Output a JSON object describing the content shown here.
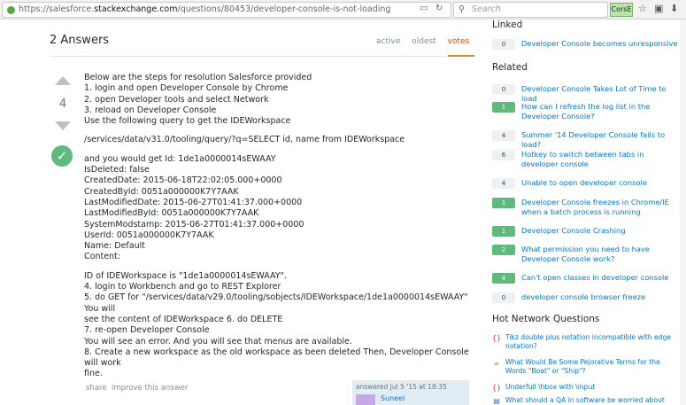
{
  "browser": {
    "url_prefix": "https://salesforce.",
    "url_domain": "stackexchange.com",
    "url_path": "/questions/80453/developer-console-is-not-loading",
    "search_placeholder": "Search",
    "extension_label": "CorsE"
  },
  "answers": {
    "header": "2 Answers",
    "tabs": [
      "active",
      "oldest",
      "votes"
    ],
    "selected_tab": "votes",
    "vote_count": "4",
    "body": [
      [
        "Below are the steps for resolution Salesforce provided",
        "1. login and open Developer Console by Chrome",
        "2. open Developer tools and select Network",
        "3. reload on Developer Console",
        "Use the following query to get the IDEWorkspace"
      ],
      [
        "/services/data/v31.0/tooling/query/?q=SELECT id, name from IDEWorkspace"
      ],
      [
        "and you would get Id: 1de1a0000014sEWAAY",
        "IsDeleted: false",
        "CreatedDate: 2015-06-18T22:02:05.000+0000",
        "CreatedById: 0051a000000K7Y7AAK",
        "LastModifiedDate: 2015-06-27T01:41:37.000+0000",
        "LastModifiedById: 0051a000000K7Y7AAK",
        "SystemModstamp: 2015-06-27T01:41:37.000+0000",
        "UserId: 0051a000000K7Y7AAK",
        "Name: Default",
        "Content:"
      ],
      [
        "ID of IDEWorkspace is \"1de1a0000014sEWAAY\".",
        "4. login to Workbench and go to REST Explorer",
        "5. do GET for \"/services/data/v29.0/tooling/sobjects/IDEWorkspace/1de1a0000014sEWAAY\" You will",
        "see the content of IDEWorkspace 6. do DELETE",
        "7. re-open Developer Console",
        "You will see an error. And you will see that menus are available.",
        "8. Create a new workspace as the old workspace as been deleted Then, Developer Console will work",
        "fine."
      ]
    ],
    "share_label": "share",
    "improve_label": "improve this answer",
    "answered_text": "answered Jul 5 '15 at 18:35",
    "user_name": "Suneel"
  },
  "sidebar": {
    "linked_title": "Linked",
    "linked": [
      {
        "count": "0",
        "title": "Developer Console becomes unresponsive",
        "accepted": false
      }
    ],
    "related_title": "Related",
    "related": [
      {
        "count": "0",
        "title": "Developer Console Takes Lot of Time to load",
        "accepted": false
      },
      {
        "count": "1",
        "title": "How can I refresh the log list in the Developer Console?",
        "accepted": true
      },
      {
        "count": "4",
        "title": "Summer '14 Developer Console fails to load?",
        "accepted": false
      },
      {
        "count": "6",
        "title": "Hotkey to switch between tabs in developer console",
        "accepted": false
      },
      {
        "count": "4",
        "title": "Unable to open developer console",
        "accepted": false
      },
      {
        "count": "1",
        "title": "Developer Console freezes in Chrome/IE when a batch process is running",
        "accepted": true
      },
      {
        "count": "1",
        "title": "Developer Console Crashing",
        "accepted": true
      },
      {
        "count": "2",
        "title": "What permission you need to have Developer Console work?",
        "accepted": true
      },
      {
        "count": "4",
        "title": "Can't open classes in developer console",
        "accepted": true
      },
      {
        "count": "0",
        "title": "developer console browser freeze",
        "accepted": false
      }
    ],
    "hnq_title": "Hot Network Questions",
    "hnq": [
      {
        "icon": "tex-icon",
        "glyph": "{}",
        "color": "#d1383d",
        "title": "Tikz double plus notation incompatible with edge notation?"
      },
      {
        "icon": "english-icon",
        "glyph": "☕",
        "color": "#8a6a3b",
        "title": "What Would Be Some Pejorative Terms for the Words \"Boat\" or \"Ship\"?"
      },
      {
        "icon": "tex-icon",
        "glyph": "{}",
        "color": "#d1383d",
        "title": "Underfull \\hbox with \\input"
      },
      {
        "icon": "sqa-icon",
        "glyph": "▤",
        "color": "#3c6fb0",
        "title": "What should a QA in software be worried about"
      }
    ]
  }
}
